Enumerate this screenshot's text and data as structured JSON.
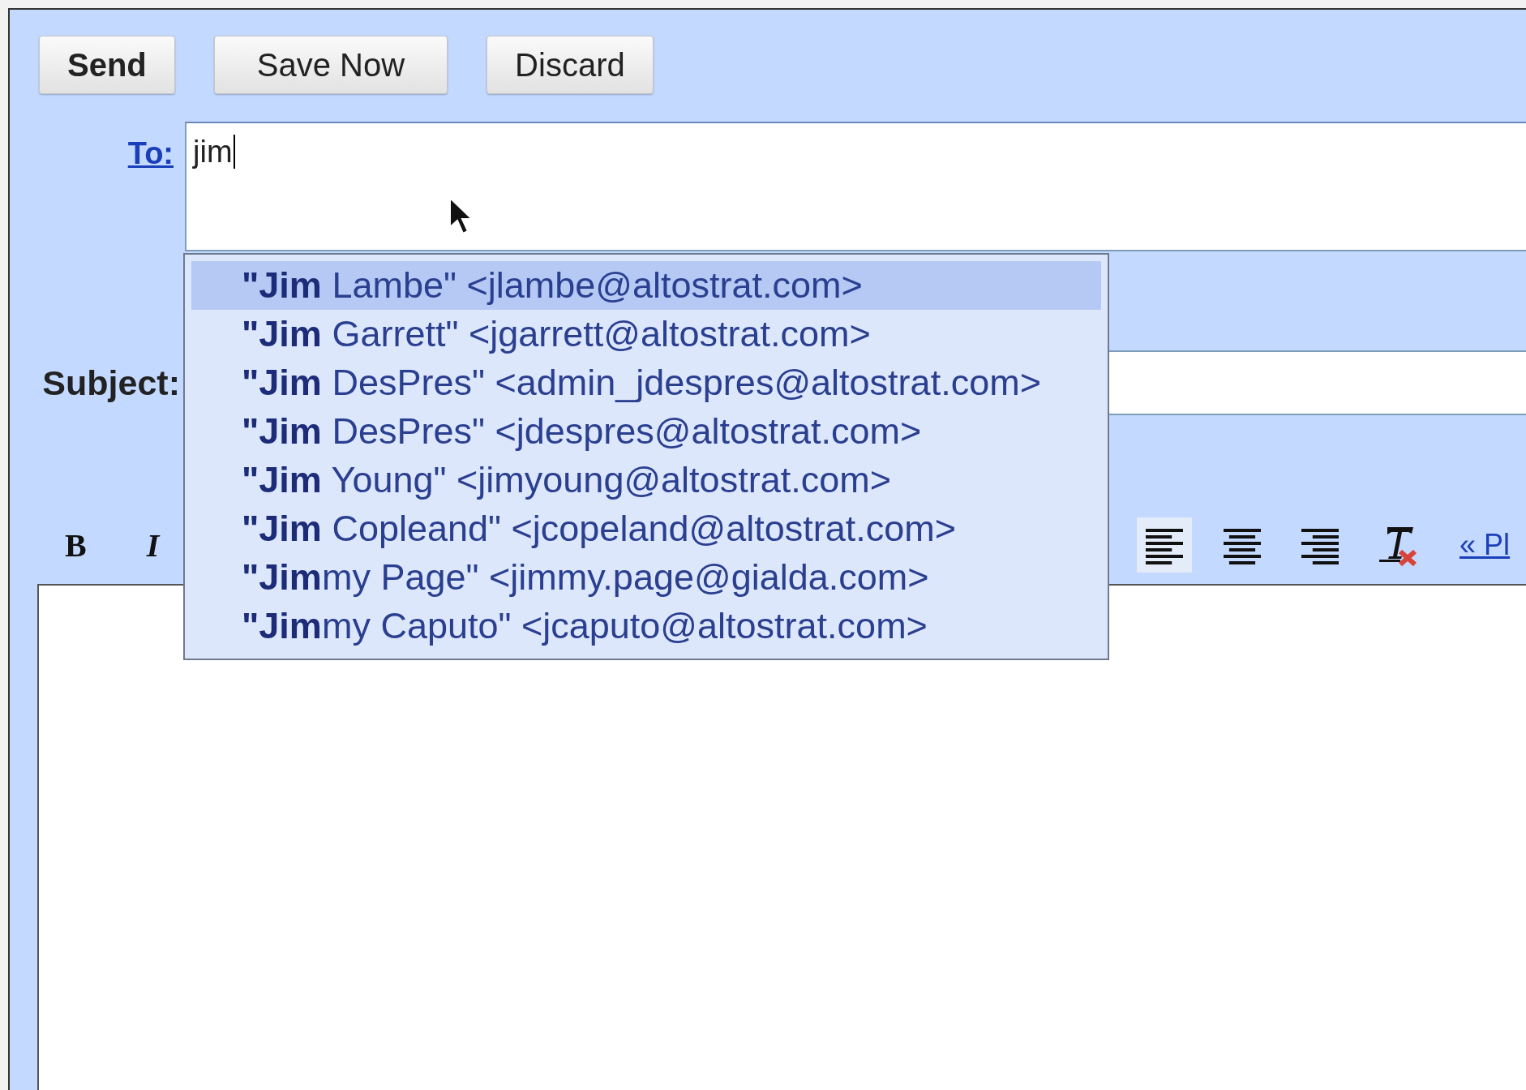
{
  "actions": [
    {
      "label": "Send",
      "primary": true
    },
    {
      "label": "Save Now",
      "primary": false
    },
    {
      "label": "Discard",
      "primary": false
    }
  ],
  "to": {
    "label": "To:",
    "value": "jim"
  },
  "suggestions": [
    {
      "text": "**\"Jim** Lambe\" <jlambe@altostrat.com>",
      "selected": true
    },
    {
      "text": "**\"Jim** Garrett\" <jgarrett@altostrat.com>",
      "selected": false
    },
    {
      "text": "**\"Jim** DesPres\" <admin_jdespres@altostrat.com>",
      "selected": false
    },
    {
      "text": "**\"Jim** DesPres\" <jdespres@altostrat.com>",
      "selected": false
    },
    {
      "text": "**\"Jim** Young\" <jimyoung@altostrat.com>",
      "selected": false
    },
    {
      "text": "**\"Jim** Copleand\" <jcopeland@altostrat.com>",
      "selected": false
    },
    {
      "text": "**\"Jim**my Page\" <jimmy.page@gialda.com>",
      "selected": false
    },
    {
      "text": "**\"Jim**my Caputo\" <jcaputo@altostrat.com>",
      "selected": false
    }
  ],
  "subject": {
    "label": "Subject:"
  },
  "toolbar_left": [
    {
      "kind": "bold",
      "label": "B"
    },
    {
      "kind": "italic",
      "label": "I"
    }
  ],
  "toolbar_right": [
    {
      "kind": "align-left",
      "selected": true
    },
    {
      "kind": "align-center",
      "selected": false
    },
    {
      "kind": "align-right",
      "selected": false
    },
    {
      "kind": "clear-format",
      "selected": false
    }
  ],
  "plain_text_link": "« Pl"
}
